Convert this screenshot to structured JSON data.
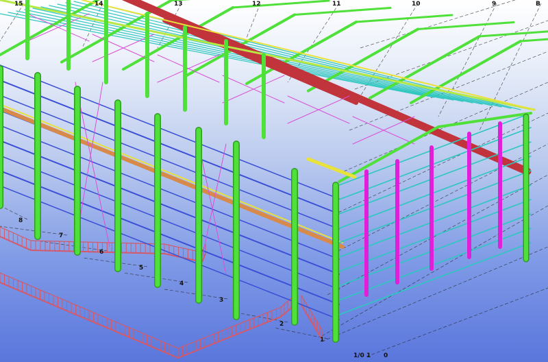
{
  "top_grid_labels": [
    "15",
    "14",
    "13",
    "12",
    "11",
    "10",
    "9",
    "B"
  ],
  "left_grid_labels": [
    "8",
    "7",
    "6",
    "5",
    "4",
    "3",
    "2",
    "1"
  ],
  "bottom_labels": [
    "1/0 1",
    "0"
  ],
  "colors": {
    "column": "#4fe03a",
    "column_dark": "#2f9a24",
    "rafter_main": "#c2343c",
    "purlin": "#2ec7c0",
    "girt": "#3a4fd6",
    "bracing": "#d94fd6",
    "magenta_column": "#e020d8",
    "beam_yellow": "#e9e23a",
    "eave": "#b7e843",
    "railing": "#d25a6a",
    "crane_beam": "#d78a4a"
  }
}
